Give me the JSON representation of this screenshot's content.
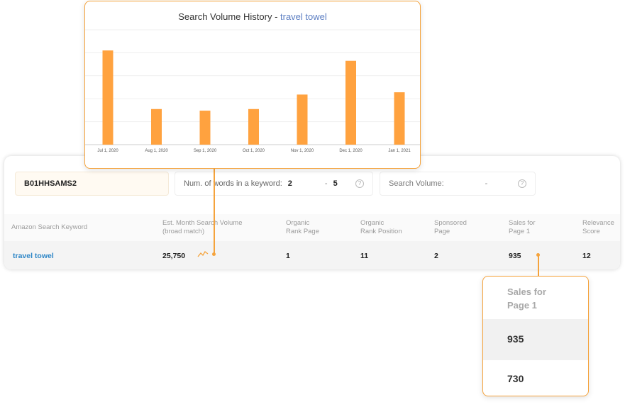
{
  "filters": {
    "asin": "B01HHSAMS2",
    "words_label": "Num. of words in a keyword:",
    "words_min": "2",
    "words_dash": "-",
    "words_max": "5",
    "volume_label": "Search Volume:",
    "volume_dash": "-"
  },
  "table": {
    "headers": [
      [
        "Amazon Search Keyword",
        ""
      ],
      [
        "Est. Month Search Volume",
        "(broad match)"
      ],
      [
        "Organic",
        "Rank Page"
      ],
      [
        "Organic",
        "Rank Position"
      ],
      [
        "Sponsored",
        "Page"
      ],
      [
        "Sales for",
        "Page 1"
      ],
      [
        "Relevance",
        "Score"
      ]
    ],
    "row": {
      "keyword": "travel towel",
      "volume": "25,750",
      "organic_rank_page": "1",
      "organic_rank_position": "11",
      "sponsored_page": "2",
      "sales_page1": "935",
      "relevance": "12"
    }
  },
  "chart_popup": {
    "title_prefix": "Search Volume History - ",
    "title_keyword": "travel towel"
  },
  "sales_popup": {
    "header_line1": "Sales for",
    "header_line2": "Page 1",
    "value1": "935",
    "value2": "730"
  },
  "colors": {
    "accent": "#f5a33c",
    "bar": "#ffa23f",
    "link": "#2f87c7"
  },
  "chart_data": {
    "type": "bar",
    "title": "Search Volume History - travel towel",
    "categories": [
      "Jul 1, 2020",
      "Aug 1, 2020",
      "Sep 1, 2020",
      "Oct 1, 2020",
      "Nov 1, 2020",
      "Dec 1, 2020",
      "Jan 1, 2021"
    ],
    "values": [
      41000,
      15500,
      14800,
      15500,
      21800,
      36500,
      22800
    ],
    "ylim": [
      0,
      50000
    ],
    "grid": true,
    "ylabel": "",
    "xlabel": ""
  }
}
